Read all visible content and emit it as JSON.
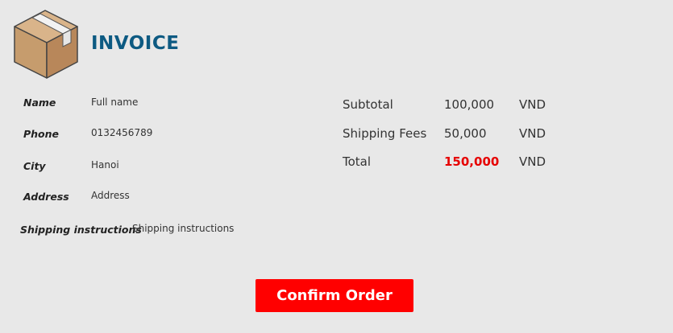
{
  "header": {
    "title": "INVOICE",
    "logo_icon": "package-box-icon"
  },
  "customer": {
    "name_label": "Name",
    "name_value": "Full name",
    "phone_label": "Phone",
    "phone_value": "0132456789",
    "city_label": "City",
    "city_value": "Hanoi",
    "address_label": "Address",
    "address_value": "Address",
    "instructions_label": "Shipping instructions",
    "instructions_value": "Shipping instructions"
  },
  "summary": {
    "rows": [
      {
        "label": "Subtotal",
        "value": "100,000",
        "unit": "VND"
      },
      {
        "label": "Shipping Fees",
        "value": "50,000",
        "unit": "VND"
      },
      {
        "label": "Total",
        "value": "150,000",
        "unit": "VND"
      }
    ],
    "total_color": "#e60000"
  },
  "actions": {
    "confirm_label": "Confirm Order",
    "confirm_color": "#ff0000"
  },
  "colors": {
    "background": "#e8e8e8",
    "title": "#0d5a82"
  }
}
